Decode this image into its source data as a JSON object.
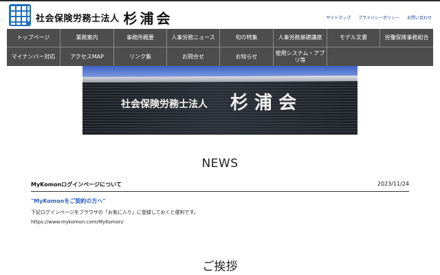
{
  "brand": {
    "prefix": "社会保険労務士法人",
    "name": "杉浦会"
  },
  "utility_links": [
    "サイトマップ",
    "プライバシーポリシー",
    "お問い合わせ"
  ],
  "nav": [
    "トップページ",
    "業務案内",
    "事務所概要",
    "人事労務ニュース",
    "旬の特集",
    "人事労務基礎講座",
    "モデル文書",
    "労働保険事務組合",
    "マイナンバー対応",
    "アクセスMAP",
    "リンク集",
    "お問合せ",
    "お知らせ",
    "使用システム・アプリ等"
  ],
  "hero": {
    "sign_prefix": "社会保険労務士法人",
    "sign_name": "杉 浦 会"
  },
  "news": {
    "heading": "NEWS",
    "item": {
      "title": "MyKomonログインページについて",
      "date": "2023/11/24",
      "link": "\"MyKomonをご契約の方へ\"",
      "body": "下記ログインページをブラウザの「お気に入り」に登録しておくと便利です。",
      "url": "https://www.mykomon.com/MyKomon/"
    }
  },
  "greeting": {
    "heading": "ご挨拶"
  },
  "colors": {
    "nav_bg": "#4d4d4d",
    "logo_blue": "#1f6fbf",
    "link_blue": "#2d5fc4"
  }
}
